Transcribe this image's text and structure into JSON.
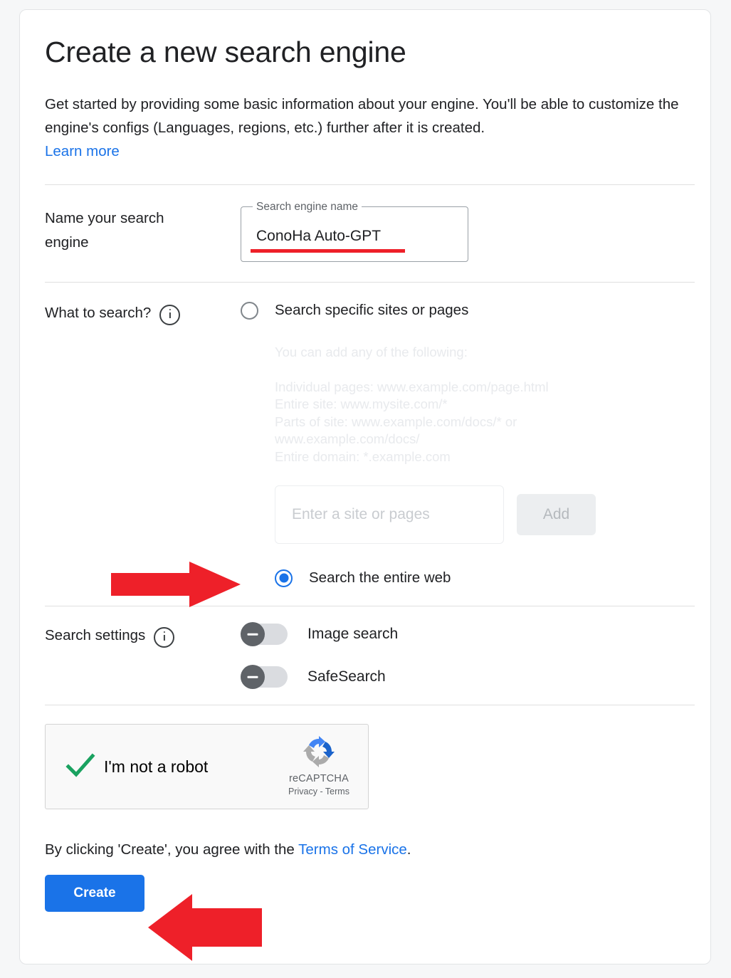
{
  "page": {
    "title": "Create a new search engine",
    "intro": "Get started by providing some basic information about your engine. You'll be able to customize the engine's configs (Languages, regions, etc.) further after it is created.",
    "learn_more": "Learn more"
  },
  "name_section": {
    "label": "Name your search engine",
    "field_legend": "Search engine name",
    "field_value": "ConoHa Auto-GPT"
  },
  "what_to_search": {
    "label": "What to search?",
    "info_icon": "info-icon",
    "option_specific": {
      "label": "Search specific sites or pages",
      "selected": false
    },
    "hint_intro": "You can add any of the following:",
    "hint_lines": [
      "Individual pages: www.example.com/page.html",
      "Entire site: www.mysite.com/*",
      "Parts of site: www.example.com/docs/* or",
      "www.example.com/docs/",
      "Entire domain: *.example.com"
    ],
    "site_input_placeholder": "Enter a site or pages",
    "site_input_value": "",
    "add_button": "Add",
    "option_entire_web": {
      "label": "Search the entire web",
      "selected": true
    }
  },
  "search_settings": {
    "label": "Search settings",
    "info_icon": "info-icon",
    "toggles": [
      {
        "label": "Image search",
        "state": "off"
      },
      {
        "label": "SafeSearch",
        "state": "off"
      }
    ]
  },
  "recaptcha": {
    "checkbox_label": "I'm not a robot",
    "checked": true,
    "brand": "reCAPTCHA",
    "privacy": "Privacy",
    "separator": "-",
    "terms": "Terms"
  },
  "footer": {
    "terms_prefix": "By clicking 'Create', you agree with the ",
    "terms_link": "Terms of Service",
    "terms_suffix": ".",
    "create_button": "Create"
  },
  "annotations": {
    "underline_color": "#ee2029",
    "arrow_color": "#ee2029",
    "arrow_right_target": "Search the entire web radio",
    "arrow_left_target": "Create button"
  },
  "colors": {
    "accent_blue": "#1a73e8",
    "link_blue": "#1a73e8",
    "annotation_red": "#ee2029",
    "page_background": "#f6f7f8",
    "card_background": "#ffffff"
  }
}
